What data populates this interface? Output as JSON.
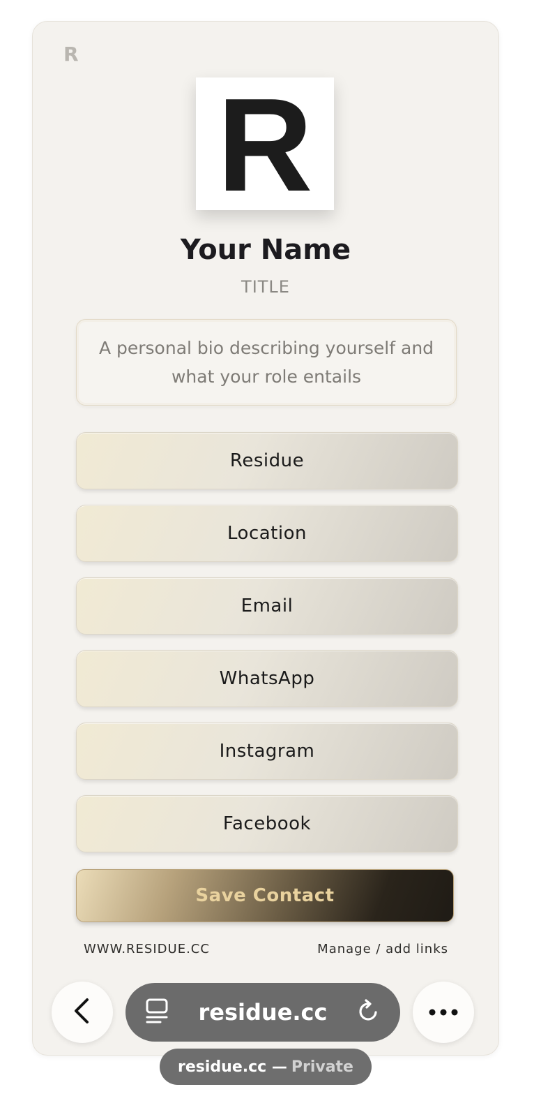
{
  "profile": {
    "corner_mark": "R",
    "logo_letter": "R",
    "name": "Your Name",
    "title": "TITLE",
    "bio": "A personal bio describing yourself and what your role entails"
  },
  "links": [
    {
      "label": "Residue"
    },
    {
      "label": "Location"
    },
    {
      "label": "Email"
    },
    {
      "label": "WhatsApp"
    },
    {
      "label": "Instagram"
    },
    {
      "label": "Facebook"
    }
  ],
  "actions": {
    "save_contact": "Save Contact"
  },
  "footer": {
    "site": "WWW.RESIDUE.CC",
    "manage": "Manage / add links"
  },
  "browser": {
    "url": "residue.cc",
    "tab_label": "residue.cc —",
    "private_label": "Private",
    "icons": {
      "back": "chevron-left-icon",
      "tabs": "page-menu-icon",
      "reload": "reload-icon",
      "more": "more-icon"
    }
  }
}
